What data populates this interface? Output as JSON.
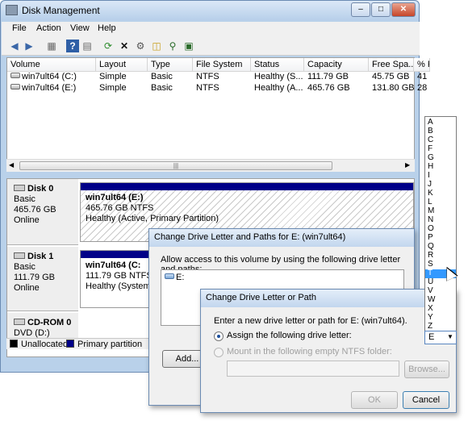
{
  "window": {
    "title": "Disk Management"
  },
  "menu": [
    "File",
    "Action",
    "View",
    "Help"
  ],
  "toolbar_icons": [
    "back-arrow-icon",
    "forward-arrow-icon",
    "properties-icon",
    "help-icon",
    "refresh-icon",
    "delete-icon",
    "disk-properties-icon",
    "open-folder-icon",
    "explore-icon",
    "settings-icon"
  ],
  "columns": [
    "Volume",
    "Layout",
    "Type",
    "File System",
    "Status",
    "Capacity",
    "Free Spa...",
    "% F"
  ],
  "volumes": [
    [
      "win7ult64 (C:)",
      "Simple",
      "Basic",
      "NTFS",
      "Healthy (S...",
      "111.79 GB",
      "45.75 GB",
      "41"
    ],
    [
      "win7ult64 (E:)",
      "Simple",
      "Basic",
      "NTFS",
      "Healthy (A...",
      "465.76 GB",
      "131.80 GB",
      "28"
    ]
  ],
  "scroll_grip": "|||",
  "disks": [
    {
      "name": "Disk 0",
      "type": "Basic",
      "size": "465.76 GB",
      "status": "Online",
      "partition": {
        "name": "win7ult64  (E:)",
        "size": "465.76 GB NTFS",
        "status": "Healthy (Active, Primary Partition)"
      }
    },
    {
      "name": "Disk 1",
      "type": "Basic",
      "size": "111.79 GB",
      "status": "Online",
      "partition": {
        "name": "win7ult64  (C:",
        "size": "111.79 GB NTFS",
        "status": "Healthy (System, E"
      }
    },
    {
      "name": "CD-ROM 0",
      "type": "DVD (D:)"
    }
  ],
  "legend": {
    "unallocated": "Unallocated",
    "primary": "Primary partition",
    "unallocated_color": "#000000",
    "primary_color": "#000088"
  },
  "dialog1": {
    "title": "Change Drive Letter and Paths for E: (win7ult64)",
    "text": "Allow access to this volume by using the following drive letter and paths:",
    "item": "E:",
    "add": "Add..."
  },
  "dialog2": {
    "title": "Change Drive Letter or Path",
    "text": "Enter a new drive letter or path for E: (win7ult64).",
    "assign": "Assign the following drive letter:",
    "mount": "Mount in the following empty NTFS folder:",
    "browse": "Browse...",
    "ok": "OK",
    "cancel": "Cancel",
    "selected_letter": "E"
  },
  "letters": [
    "A",
    "B",
    "C",
    "F",
    "G",
    "H",
    "I",
    "J",
    "K",
    "L",
    "M",
    "N",
    "O",
    "P",
    "Q",
    "R",
    "S",
    "T",
    "U",
    "V",
    "W",
    "X",
    "Y",
    "Z"
  ],
  "highlighted_letter": "T"
}
